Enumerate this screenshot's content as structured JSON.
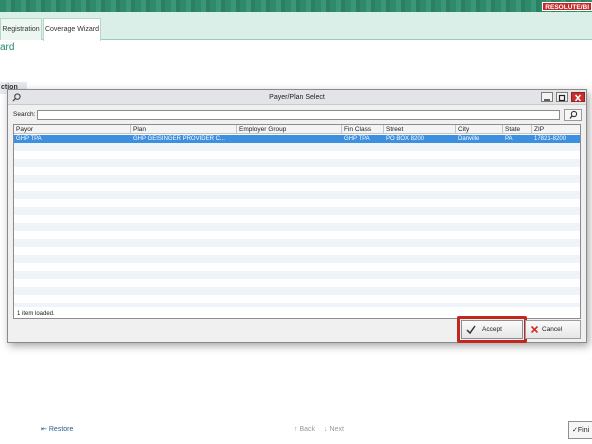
{
  "badge": "RESOLUTE/BI",
  "tabs": [
    {
      "label": "Registration"
    },
    {
      "label": "Coverage Wizard"
    }
  ],
  "page_title": "ard",
  "side_label": "ction",
  "dialog": {
    "title": "Payer/Plan Select",
    "search_label": "Search:",
    "search_value": "",
    "columns": [
      "Payor",
      "Plan",
      "Employer Group",
      "Fin Class",
      "Street",
      "City",
      "State",
      "ZIP"
    ],
    "rows": [
      {
        "payor": "GHP TPA",
        "plan": "GHP GEISINGER PROVIDER C...",
        "employer_group": "",
        "fin_class": "GHP TPA",
        "street": "PO BOX 8200",
        "city": "Danville",
        "state": "PA",
        "zip": "17821-8200"
      }
    ],
    "status": "1 item loaded.",
    "accept_label": "Accept",
    "cancel_label": "Cancel",
    "highlight_color": "#c0271f",
    "selection_color": "#3d8fe0"
  },
  "footer": {
    "restore_label": "Restore",
    "back_label": "Back",
    "next_label": "Next",
    "finish_label": "Fini"
  }
}
